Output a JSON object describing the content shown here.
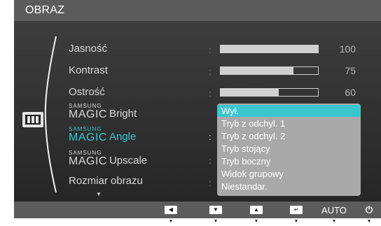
{
  "menu": {
    "title": "OBRAZ"
  },
  "items": [
    {
      "label": "Jasność",
      "value": "100",
      "fill": 1.0
    },
    {
      "label": "Kontrast",
      "value": "75",
      "fill": 0.75
    },
    {
      "label": "Ostrość",
      "value": "60",
      "fill": 0.6
    },
    {
      "logo_top": "SAMSUNG",
      "logo_bottom": "MAGIC",
      "label": "Bright"
    },
    {
      "logo_top": "SAMSUNG",
      "logo_bottom": "MAGIC",
      "label": "Angle"
    },
    {
      "logo_top": "SAMSUNG",
      "logo_bottom": "MAGIC",
      "label": "Upscale"
    },
    {
      "label": "Rozmiar obrazu"
    }
  ],
  "separator": ":",
  "scroll_indicator": "▼",
  "dropdown": {
    "selected": "Wył.",
    "options": [
      "Wył.",
      "Tryb z odchyl. 1",
      "Tryb z odchyl. 2",
      "Tryb stojący",
      "Tryb boczny",
      "Widok grupowy",
      "Niestandar."
    ]
  },
  "buttons": {
    "left": "◀",
    "down": "▼",
    "up": "▲",
    "enter": "↵",
    "auto": "AUTO",
    "power": "⏻"
  },
  "tick": "▼",
  "colors": {
    "accent": "#39c6cf",
    "dropdown_bg": "#a9a9a9",
    "panel": "#2f2f2f"
  }
}
